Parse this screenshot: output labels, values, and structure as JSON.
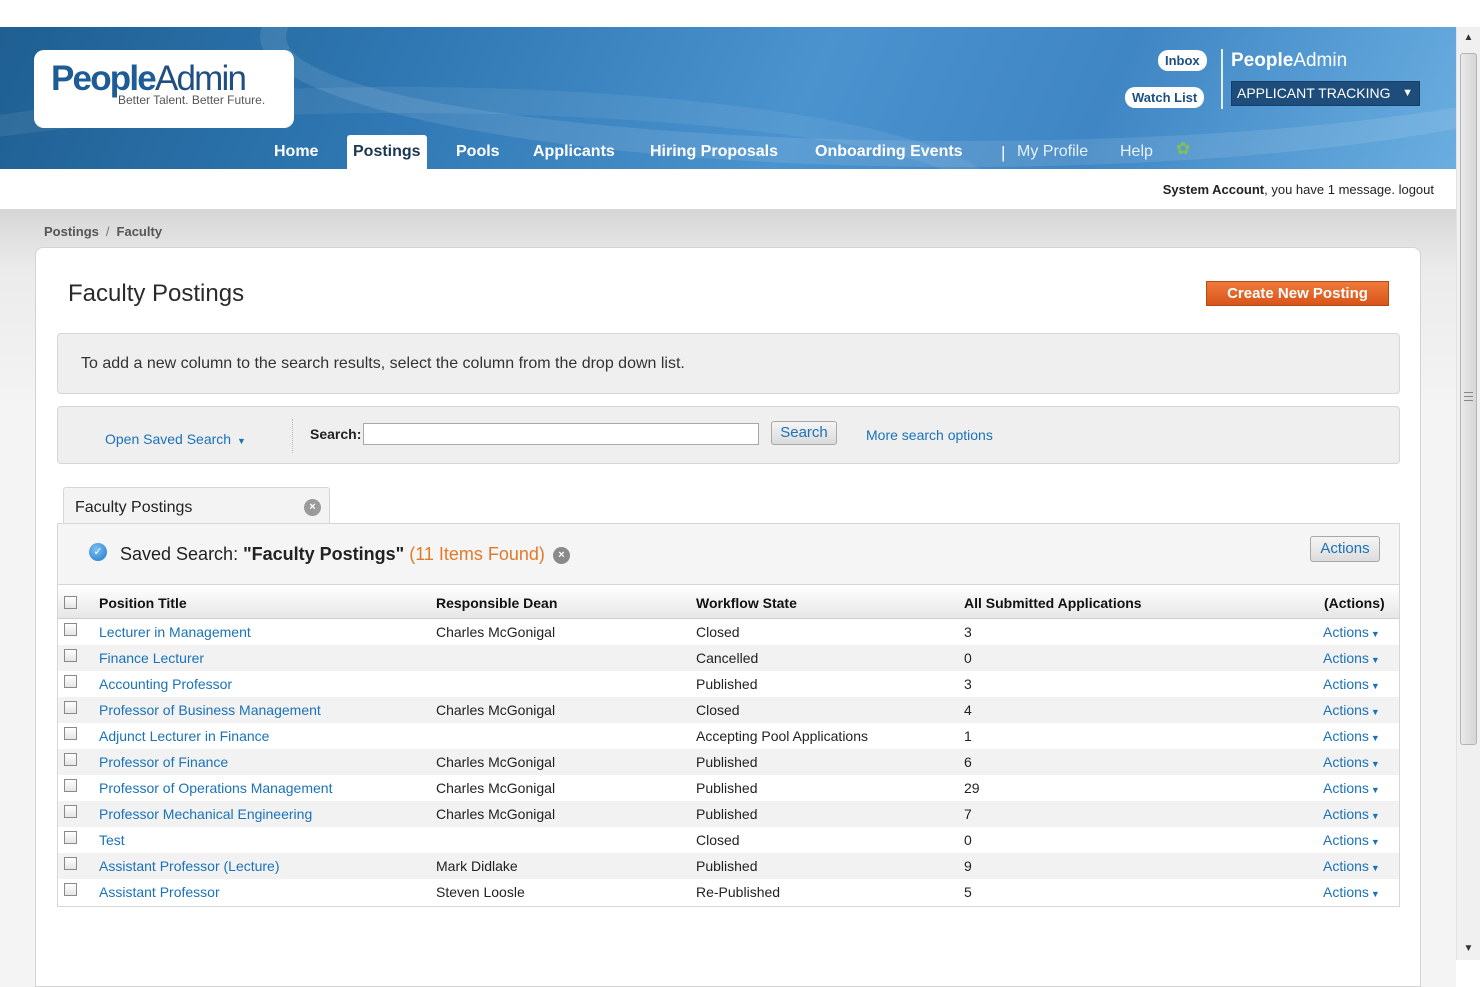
{
  "logo": {
    "name_bold": "People",
    "name_light": "Admin",
    "tagline": "Better Talent. Better Future."
  },
  "header": {
    "inbox": "Inbox",
    "watch_list": "Watch List",
    "brand_bold": "People",
    "brand_light": "Admin",
    "module_select": "APPLICANT TRACKING",
    "nav": [
      {
        "label": "Home"
      },
      {
        "label": "Postings",
        "active": true
      },
      {
        "label": "Pools"
      },
      {
        "label": "Applicants"
      },
      {
        "label": "Hiring Proposals"
      },
      {
        "label": "Onboarding Events"
      },
      {
        "label": "My Profile"
      },
      {
        "label": "Help"
      }
    ],
    "nav_separator": "|"
  },
  "message_bar": {
    "user": "System Account",
    "text": ", you have 1 message.",
    "logout": "logout"
  },
  "breadcrumb": {
    "items": [
      "Postings",
      "Faculty"
    ],
    "separator": "/"
  },
  "page": {
    "title": "Faculty Postings",
    "create_button": "Create New Posting",
    "info_text": "To add a new column to the search results, select the column from the drop down list."
  },
  "search": {
    "open_saved": "Open Saved Search",
    "label": "Search:",
    "input_value": "",
    "button": "Search",
    "more_options": "More search options"
  },
  "tab": {
    "label": "Faculty Postings"
  },
  "results": {
    "prefix": "Saved Search: ",
    "name": "\"Faculty Postings\"",
    "found": "(11 Items Found)",
    "actions_button": "Actions",
    "columns": {
      "title": "Position Title",
      "dean": "Responsible Dean",
      "state": "Workflow State",
      "apps": "All Submitted Applications",
      "actions": "(Actions)"
    },
    "action_link": "Actions",
    "rows": [
      {
        "title": "Lecturer in Management",
        "dean": "Charles McGonigal",
        "state": "Closed",
        "apps": "3"
      },
      {
        "title": "Finance Lecturer",
        "dean": "",
        "state": "Cancelled",
        "apps": "0"
      },
      {
        "title": "Accounting Professor",
        "dean": "",
        "state": "Published",
        "apps": "3"
      },
      {
        "title": "Professor of Business Management",
        "dean": "Charles McGonigal",
        "state": "Closed",
        "apps": "4"
      },
      {
        "title": "Adjunct Lecturer in Finance",
        "dean": "",
        "state": "Accepting Pool Applications",
        "apps": "1"
      },
      {
        "title": "Professor of Finance",
        "dean": "Charles McGonigal",
        "state": "Published",
        "apps": "6"
      },
      {
        "title": "Professor of Operations Management",
        "dean": "Charles McGonigal",
        "state": "Published",
        "apps": "29"
      },
      {
        "title": "Professor Mechanical Engineering",
        "dean": "Charles McGonigal",
        "state": "Published",
        "apps": "7"
      },
      {
        "title": "Test",
        "dean": "",
        "state": "Closed",
        "apps": "0"
      },
      {
        "title": "Assistant Professor (Lecture)",
        "dean": "Mark Didlake",
        "state": "Published",
        "apps": "9"
      },
      {
        "title": "Assistant Professor",
        "dean": "Steven Loosle",
        "state": "Re-Published",
        "apps": "5"
      }
    ]
  },
  "colors": {
    "brand_blue": "#2f78b3",
    "link": "#1a72b8",
    "create_button": "#e0601f",
    "found_count": "#e07a2a"
  },
  "icons": {
    "gear": "gear-icon",
    "check": "check-circle-icon",
    "close": "close-icon",
    "dropdown": "chevron-down-icon"
  }
}
